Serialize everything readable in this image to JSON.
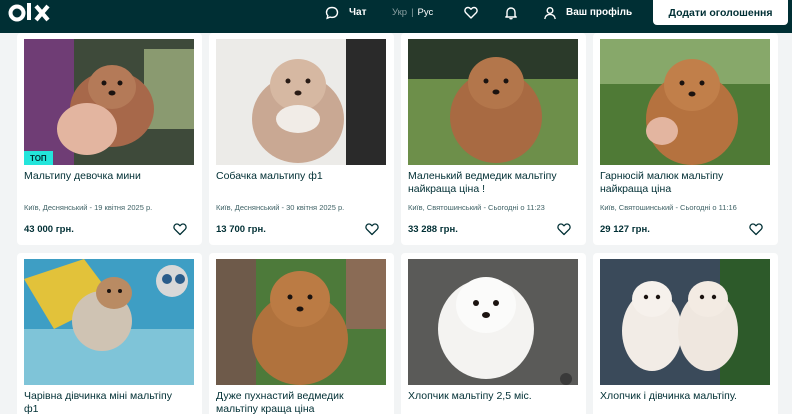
{
  "header": {
    "logo": "olx",
    "chat_label": "Чат",
    "lang_ukr": "Укр",
    "lang_separator": "|",
    "lang_rus": "Рус",
    "profile_label": "Ваш профіль",
    "post_ad_label": "Додати оголошення"
  },
  "listings": [
    {
      "title": "Мальтипу девочка мини",
      "location_date": "Київ, Деснянський - 19 квітня 2025 р.",
      "price": "43 000 грн.",
      "badge": "ТОП"
    },
    {
      "title": "Собачка мальтипу ф1",
      "location_date": "Київ, Деснянський - 30 квітня 2025 р.",
      "price": "13 700 грн."
    },
    {
      "title": "Маленький ведмедик мальтіпу найкраща ціна !",
      "location_date": "Київ, Святошинський - Сьогодні о 11:23",
      "price": "33 288 грн."
    },
    {
      "title": "Гарнюсій малюк мальтіпу найкраща ціна",
      "location_date": "Київ, Святошинський - Сьогодні о 11:16",
      "price": "29 127 грн."
    },
    {
      "title": "Чарівна дівчинка міні мальтіпу ф1"
    },
    {
      "title": "Дуже пухнастий ведмедик мальтіпу краща ціна"
    },
    {
      "title": "Хлопчик мальтіпу 2,5 міс."
    },
    {
      "title": "Хлопчик і дівчинка мальтіпу."
    }
  ]
}
